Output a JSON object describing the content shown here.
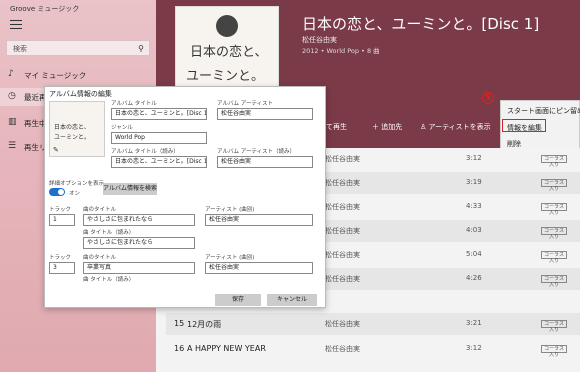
{
  "app": {
    "title": "Groove ミュージック"
  },
  "sidebar": {
    "search_placeholder": "検索",
    "items": [
      {
        "icon": "music-note-icon",
        "label": "マイ ミュージック"
      },
      {
        "icon": "clock-icon",
        "label": "最近再生"
      },
      {
        "icon": "equalizer-icon",
        "label": "再生中"
      },
      {
        "icon": "list-icon",
        "label": "再生リ..."
      }
    ]
  },
  "album": {
    "title": "日本の恋と、ユーミンと。[Disc 1]",
    "artist": "松任谷由実",
    "meta": "2012 • World Pop • 8 曲",
    "cover_line1": "日本の恋と、",
    "cover_line2": "ユーミンと。"
  },
  "header_buttons": {
    "play": "て再生",
    "add": "＋ 追加先",
    "show_artist": "アーティストを表示",
    "more": "···"
  },
  "context_menu": {
    "step_badge": "5",
    "items": [
      "スタート画面にピン留め",
      "情報を編集",
      "削除"
    ]
  },
  "tracks": [
    {
      "num": "",
      "title": "",
      "artist": "松任谷由実",
      "duration": "3:12",
      "badge": "コーラス入り"
    },
    {
      "num": "",
      "title": "",
      "artist": "松任谷由実",
      "duration": "3:19",
      "badge": "コーラス入り"
    },
    {
      "num": "",
      "title": "",
      "artist": "松任谷由実",
      "duration": "4:33",
      "badge": "コーラス入り"
    },
    {
      "num": "",
      "title": "",
      "artist": "松任谷由実",
      "duration": "4:03",
      "badge": "コーラス入り"
    },
    {
      "num": "",
      "title": "",
      "artist": "松任谷由実",
      "duration": "5:04",
      "badge": "コーラス入り"
    },
    {
      "num": "",
      "title": "",
      "artist": "松任谷由実",
      "duration": "4:26",
      "badge": "コーラス入り"
    },
    {
      "num": "15",
      "title": "12月の雨",
      "artist": "松任谷由実",
      "duration": "3:21",
      "badge": "コーラス入り"
    },
    {
      "num": "16",
      "title": "A HAPPY NEW YEAR",
      "artist": "松任谷由実",
      "duration": "3:12",
      "badge": "コーラス入り"
    }
  ],
  "dialog": {
    "title": "アルバム情報の編集",
    "album_title_label": "アルバム タイトル",
    "album_title_value": "日本の恋と、ユーミンと。[Disc 1]",
    "album_artist_label": "アルバム アーティスト",
    "album_artist_value": "松任谷由実",
    "genre_label": "ジャンル",
    "genre_value": "World Pop",
    "album_title_reading_label": "アルバム タイトル（読み）",
    "album_title_reading_value": "日本の恋と、ユーミンと。[Disc 1]",
    "album_artist_reading_label": "アルバム アーティスト（読み）",
    "album_artist_reading_value": "松任谷由実",
    "advanced_label": "詳細オプションを表示",
    "toggle_state": "オン",
    "search_button": "アルバム情報を検索",
    "track1": {
      "track_label": "トラック",
      "track_value": "1",
      "song_label": "曲のタイトル",
      "song_value": "やさしさに包まれたなら",
      "song_reading_label": "曲 タイトル（読み）",
      "song_reading_value": "やさしさに包まれたなら",
      "artist_label": "アーティスト (曲別)",
      "artist_value": "松任谷由実"
    },
    "track2": {
      "track_label": "トラック",
      "track_value": "3",
      "song_label": "曲のタイトル",
      "song_value": "卒業写真",
      "song_reading_label": "曲 タイトル（読み）",
      "artist_label": "アーティスト (曲別)",
      "artist_value": "松任谷由実"
    },
    "save": "保存",
    "cancel": "キャンセル"
  }
}
